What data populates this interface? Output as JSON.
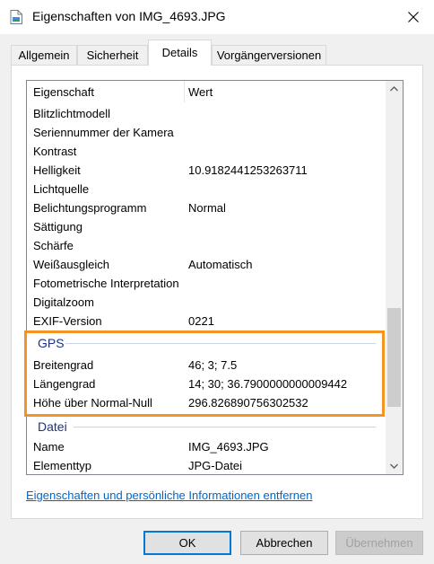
{
  "window": {
    "title": "Eigenschaften von IMG_4693.JPG"
  },
  "tabs": [
    "Allgemein",
    "Sicherheit",
    "Details",
    "Vorgängerversionen"
  ],
  "active_tab": "Details",
  "list": {
    "header": {
      "property": "Eigenschaft",
      "value": "Wert"
    },
    "rows_camera": [
      {
        "property": "Blitzlichtmodell",
        "value": ""
      },
      {
        "property": "Seriennummer der Kamera",
        "value": ""
      },
      {
        "property": "Kontrast",
        "value": ""
      },
      {
        "property": "Helligkeit",
        "value": "10.9182441253263711"
      },
      {
        "property": "Lichtquelle",
        "value": ""
      },
      {
        "property": "Belichtungsprogramm",
        "value": "Normal"
      },
      {
        "property": "Sättigung",
        "value": ""
      },
      {
        "property": "Schärfe",
        "value": ""
      },
      {
        "property": "Weißausgleich",
        "value": "Automatisch"
      },
      {
        "property": "Fotometrische Interpretation",
        "value": ""
      },
      {
        "property": "Digitalzoom",
        "value": ""
      },
      {
        "property": "EXIF-Version",
        "value": "0221"
      }
    ],
    "group_gps": "GPS",
    "rows_gps": [
      {
        "property": "Breitengrad",
        "value": "46; 3; 7.5"
      },
      {
        "property": "Längengrad",
        "value": "14; 30; 36.7900000000009442"
      },
      {
        "property": "Höhe über Normal-Null",
        "value": "296.826890756302532"
      }
    ],
    "group_file": "Datei",
    "rows_file": [
      {
        "property": "Name",
        "value": "IMG_4693.JPG"
      },
      {
        "property": "Elementtyp",
        "value": "JPG-Datei"
      }
    ]
  },
  "link_remove": "Eigenschaften und persönliche Informationen entfernen",
  "buttons": {
    "ok": "OK",
    "cancel": "Abbrechen",
    "apply": "Übernehmen"
  },
  "colors": {
    "highlight": "#f39425",
    "group_text": "#1e3287",
    "link": "#0066cc"
  }
}
